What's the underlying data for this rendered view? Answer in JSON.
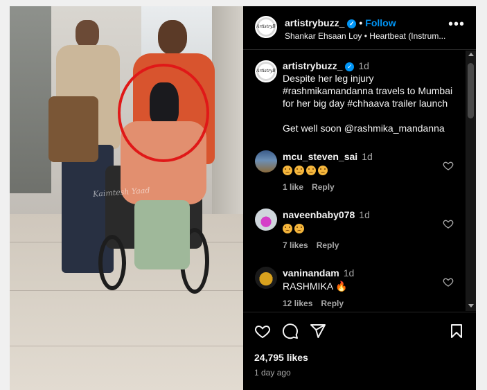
{
  "post": {
    "username": "artistrybuzz_",
    "follow_label": "Follow",
    "separator": "•",
    "audio": "Shankar Ehsaan Loy • Heartbeat (Instrum...",
    "more_label": "•••",
    "avatar_mark": "ArtistryBuzz",
    "watermark": "Kaimtesh Yaad"
  },
  "caption": {
    "username": "artistrybuzz_",
    "time": "1d",
    "line1": "Despite her leg injury",
    "line2": "#rashmikamandanna travels to Mumbai",
    "line3": "for her big day #chhaava trailer launch",
    "line4": "Get well soon @rashmika_mandanna"
  },
  "comments": [
    {
      "username": "mcu_steven_sai",
      "time": "1d",
      "likes": "1 like",
      "reply": "Reply",
      "sad_count": 4,
      "avatar_colors": [
        "#3b5c8a",
        "#8a6a3b"
      ]
    },
    {
      "username": "naveenbaby078",
      "time": "1d",
      "likes": "7 likes",
      "reply": "Reply",
      "sad_count": 2,
      "avatar_colors": [
        "#cfd6dc",
        "#d53fc8"
      ]
    },
    {
      "username": "vaninandam",
      "time": "1d",
      "text": "RASHMIKA 🔥",
      "likes": "12 likes",
      "reply": "Reply",
      "avatar_colors": [
        "#1a1a1a",
        "#d9a21e"
      ]
    }
  ],
  "stats": {
    "likes": "24,795 likes",
    "ago": "1 day ago"
  },
  "colors": {
    "accent": "#0095f6",
    "highlight_circle": "#e01818"
  }
}
